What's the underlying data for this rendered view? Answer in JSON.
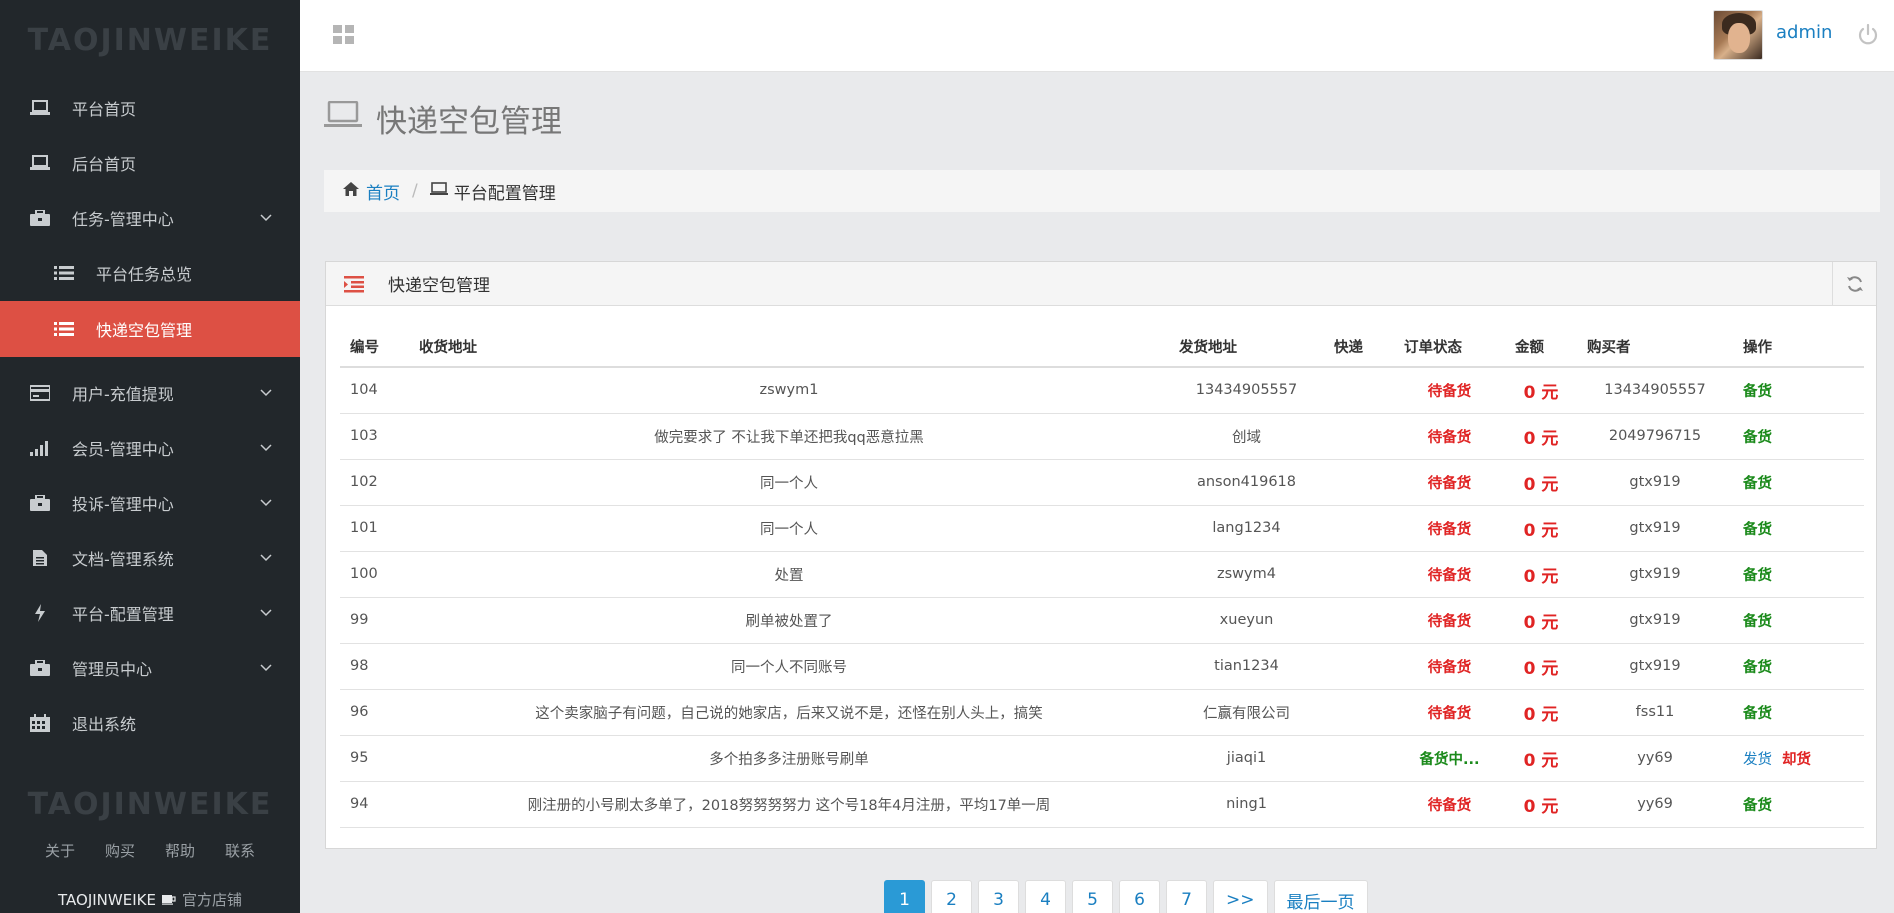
{
  "sidebar": {
    "brand": "TAOJINWEIKE",
    "items": [
      {
        "label": "平台首页",
        "icon": "laptop-icon"
      },
      {
        "label": "后台首页",
        "icon": "laptop-icon"
      },
      {
        "label": "任务-管理中心",
        "icon": "briefcase-icon"
      },
      {
        "label": "平台任务总览",
        "icon": "list-icon"
      },
      {
        "label": "快递空包管理",
        "icon": "list-icon"
      },
      {
        "label": "用户-充值提现",
        "icon": "credit-card-icon"
      },
      {
        "label": "会员-管理中心",
        "icon": "signal-icon"
      },
      {
        "label": "投诉-管理中心",
        "icon": "briefcase-icon"
      },
      {
        "label": "文档-管理系统",
        "icon": "file-icon"
      },
      {
        "label": "平台-配置管理",
        "icon": "bolt-icon"
      },
      {
        "label": "管理员中心",
        "icon": "briefcase-icon"
      },
      {
        "label": "退出系统",
        "icon": "calendar-icon"
      }
    ],
    "footer_brand": "TAOJINWEIKE",
    "footer_links": [
      "关于",
      "购买",
      "帮助",
      "联系"
    ],
    "footer_shop_brand": "TAOJINWEIKE",
    "footer_shop_label": "官方店铺"
  },
  "topbar": {
    "username": "admin"
  },
  "page": {
    "title": "快递空包管理"
  },
  "breadcrumb": {
    "home": "首页",
    "current": "平台配置管理"
  },
  "panel": {
    "title": "快递空包管理"
  },
  "table": {
    "headers": [
      "编号",
      "收货地址",
      "发货地址",
      "快递",
      "订单状态",
      "金额",
      "购买者",
      "操作"
    ],
    "rows": [
      {
        "id": "104",
        "recv": "zswym1",
        "send": "13434905557",
        "express": "",
        "status": "待备货",
        "amount": "0 元",
        "buyer": "13434905557",
        "action": "备货"
      },
      {
        "id": "103",
        "recv": "做完要求了 不让我下单还把我qq恶意拉黑",
        "send": "创域",
        "express": "",
        "status": "待备货",
        "amount": "0 元",
        "buyer": "2049796715",
        "action": "备货"
      },
      {
        "id": "102",
        "recv": "同一个人",
        "send": "anson419618",
        "express": "",
        "status": "待备货",
        "amount": "0 元",
        "buyer": "gtx919",
        "action": "备货"
      },
      {
        "id": "101",
        "recv": "同一个人",
        "send": "lang1234",
        "express": "",
        "status": "待备货",
        "amount": "0 元",
        "buyer": "gtx919",
        "action": "备货"
      },
      {
        "id": "100",
        "recv": "处置",
        "send": "zswym4",
        "express": "",
        "status": "待备货",
        "amount": "0 元",
        "buyer": "gtx919",
        "action": "备货"
      },
      {
        "id": "99",
        "recv": "刷单被处置了",
        "send": "xueyun",
        "express": "",
        "status": "待备货",
        "amount": "0 元",
        "buyer": "gtx919",
        "action": "备货"
      },
      {
        "id": "98",
        "recv": "同一个人不同账号",
        "send": "tian1234",
        "express": "",
        "status": "待备货",
        "amount": "0 元",
        "buyer": "gtx919",
        "action": "备货"
      },
      {
        "id": "96",
        "recv": "这个卖家脑子有问题，自己说的她家店，后来又说不是，还怪在别人头上，搞笑",
        "send": "仁赢有限公司",
        "express": "",
        "status": "待备货",
        "amount": "0 元",
        "buyer": "fss11",
        "action": "备货"
      },
      {
        "id": "95",
        "recv": "多个拍多多注册账号刷单",
        "send": "jiaqi1",
        "express": "",
        "status": "备货中...",
        "amount": "0 元",
        "buyer": "yy69",
        "action": "发货",
        "action2": "却货"
      },
      {
        "id": "94",
        "recv": "刚注册的小号刷太多单了，2018努努努努力 这个号18年4月注册，平均17单一周",
        "send": "ning1",
        "express": "",
        "status": "待备货",
        "amount": "0 元",
        "buyer": "yy69",
        "action": "备货"
      }
    ]
  },
  "pagination": {
    "pages": [
      "1",
      "2",
      "3",
      "4",
      "5",
      "6",
      "7",
      ">>",
      "最后一页"
    ],
    "current": "1"
  },
  "colors": {
    "sidebar_bg": "#22272b",
    "active_item": "#dd5044",
    "link_blue": "#1a7fc1",
    "status_red": "#e02424",
    "status_green": "#1b8a1b",
    "pager_active": "#2a9ad6"
  }
}
